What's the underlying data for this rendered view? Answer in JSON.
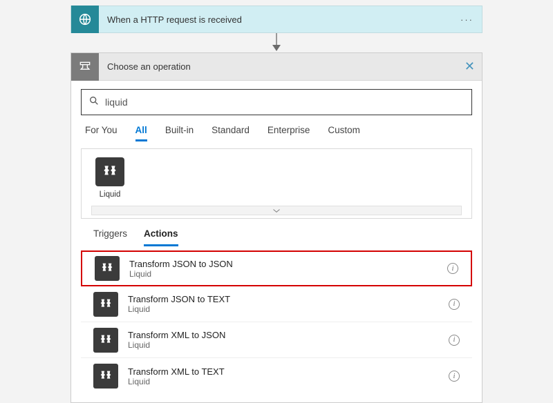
{
  "trigger": {
    "title": "When a HTTP request is received",
    "menu": "···"
  },
  "operation": {
    "header_title": "Choose an operation",
    "search_value": "liquid",
    "tabs": [
      "For You",
      "All",
      "Built-in",
      "Standard",
      "Enterprise",
      "Custom"
    ],
    "active_tab_index": 1,
    "connector": {
      "label": "Liquid"
    },
    "subtabs": [
      "Triggers",
      "Actions"
    ],
    "active_subtab_index": 1,
    "actions": [
      {
        "title": "Transform JSON to JSON",
        "provider": "Liquid",
        "highlighted": true
      },
      {
        "title": "Transform JSON to TEXT",
        "provider": "Liquid",
        "highlighted": false
      },
      {
        "title": "Transform XML to JSON",
        "provider": "Liquid",
        "highlighted": false
      },
      {
        "title": "Transform XML to TEXT",
        "provider": "Liquid",
        "highlighted": false
      }
    ]
  }
}
